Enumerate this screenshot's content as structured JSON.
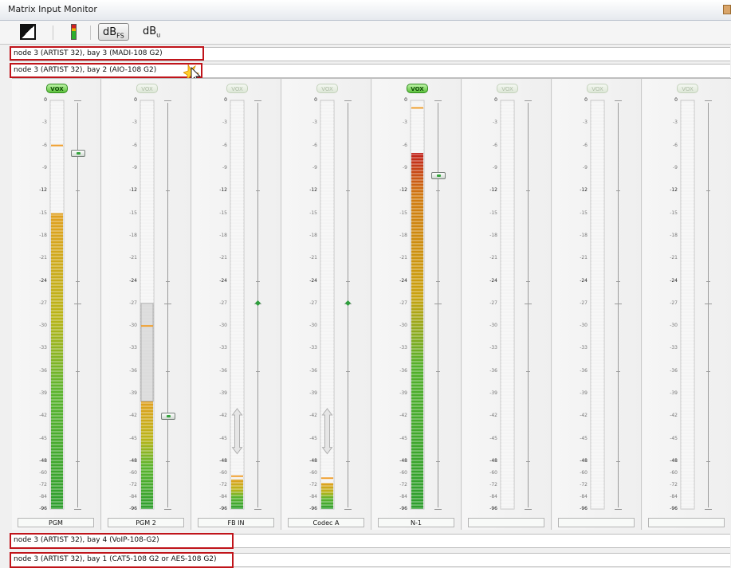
{
  "window": {
    "title": "Matrix Input Monitor"
  },
  "toolbar": {
    "contrast_icon": "contrast-icon",
    "meter_icon": "level-meter-icon",
    "dbfs": {
      "main": "dB",
      "sub": "FS"
    },
    "dbu": {
      "main": "dB",
      "sub": "u"
    }
  },
  "bays": {
    "bay3": "node 3 (ARTIST 32), bay 3 (MADI-108 G2)",
    "bay2": "node 3 (ARTIST 32), bay 2 (AIO-108 G2)",
    "bay4": "node 3 (ARTIST 32), bay 4 (VoIP-108-G2)",
    "bay1": "node 3 (ARTIST 32), bay 1 (CAT5-108 G2 or AES-108 G2)"
  },
  "scale": [
    "0",
    "-3",
    "-6",
    "-9",
    "-12",
    "-15",
    "-18",
    "-21",
    "-24",
    "-27",
    "-30",
    "-33",
    "-36",
    "-39",
    "-42",
    "-45",
    "-48",
    "-60",
    "-72",
    "-84",
    "-96"
  ],
  "vox_label": "VOX",
  "colors": {
    "highlight": "#c0141a",
    "meter_green": "#2cae2c",
    "meter_orange": "#e08a00",
    "meter_red": "#c01010"
  },
  "channels": [
    {
      "name": "PGM",
      "vox": true,
      "level_db": -15,
      "peak_db": -6,
      "fader_db": -7
    },
    {
      "name": "PGM 2",
      "vox": false,
      "level_db": -40,
      "peak_db": -30,
      "fader_db": -42,
      "peak_range": [
        -27,
        -40
      ]
    },
    {
      "name": "FB IN",
      "vox": false,
      "level_db": -66,
      "peak_db": -63,
      "fader_db": -27
    },
    {
      "name": "Codec A",
      "vox": false,
      "level_db": -70,
      "peak_db": -65,
      "fader_db": -27
    },
    {
      "name": "N-1",
      "vox": true,
      "level_db": -7,
      "peak_db": -1,
      "fader_db": -10
    },
    {
      "name": "",
      "vox": false
    },
    {
      "name": "",
      "vox": false
    },
    {
      "name": "",
      "vox": false
    }
  ]
}
